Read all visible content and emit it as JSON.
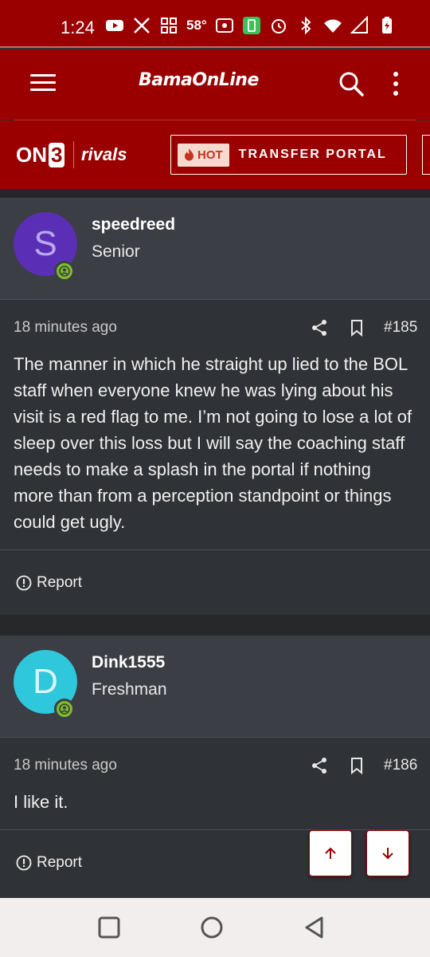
{
  "status_bar": {
    "time": "1:24",
    "temperature": "58°",
    "icons": [
      "youtube-icon",
      "x-icon",
      "grid-icon",
      "radio-icon",
      "battery-saver-icon",
      "alarm-icon",
      "bluetooth-icon",
      "wifi-icon",
      "signal-icon",
      "battery-icon"
    ]
  },
  "header": {
    "logo_text": "BamaOnLine",
    "brand_on3": "ON",
    "brand_on3_num": "3",
    "brand_rivals": "rivals",
    "hot_label": "HOT",
    "portal_label": "TRANSFER PORTAL"
  },
  "posts": [
    {
      "initial": "S",
      "avatar_color": "#5b2fb5",
      "avatar_text_color": "#b9a7f0",
      "username": "speedreed",
      "rank": "Senior",
      "time": "18 minutes ago",
      "number": "#185",
      "text": "The manner in which he straight up lied to the BOL staff when everyone knew he was lying about his visit is a red flag to me. I’m not going to lose a lot of sleep over this loss but I will say the coaching staff needs to make a splash in the portal if nothing more than from a perception standpoint or things could get ugly.",
      "report_label": "Report"
    },
    {
      "initial": "D",
      "avatar_color": "#2ec7dc",
      "avatar_text_color": "#d9f6fb",
      "username": "Dink1555",
      "rank": "Freshman",
      "time": "18 minutes ago",
      "number": "#186",
      "text": "I like it.",
      "report_label": "Report"
    }
  ],
  "colors": {
    "brand_red": "#9a0000",
    "online_badge": "#7dbe2b"
  }
}
